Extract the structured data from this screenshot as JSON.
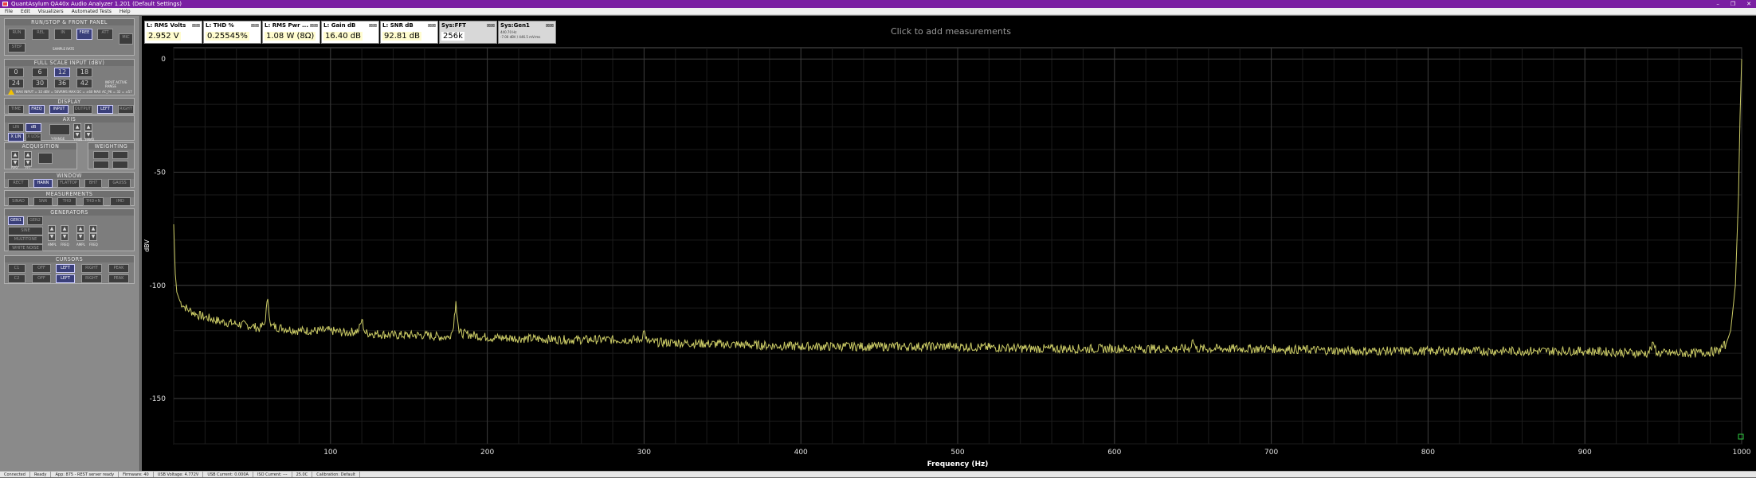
{
  "window": {
    "title": "QuantAsylum QA40x Audio Analyzer 1.201 (Default Settings)",
    "controls": [
      "–",
      "❐",
      "✕"
    ]
  },
  "menu": [
    "File",
    "Edit",
    "Visualizers",
    "Automated Tests",
    "Help"
  ],
  "panel": {
    "run": {
      "title": "RUN/STOP & FRONT PANEL",
      "buttons": [
        "RUN",
        "REL",
        "IN",
        "FREE",
        "ATT",
        "MIC"
      ],
      "bottom": [
        "STEP",
        "SAMPLE RATE"
      ]
    },
    "fullscale": {
      "title": "FULL SCALE INPUT (dBV)",
      "row1": [
        "0",
        "6",
        "12",
        "18"
      ],
      "row2": [
        "24",
        "30",
        "36",
        "42"
      ],
      "side": "INPUT ACTIVE RANGE",
      "warning": "MAX INPUT = 32 dBV = 56VRMS   MAX DC = ±60   MAX AC_PK = 32 = ±57"
    },
    "display": {
      "title": "DISPLAY",
      "buttons": [
        "TIME",
        "FREQ",
        "INPUT",
        "OUTPUT",
        "LEFT",
        "RIGHT"
      ]
    },
    "axis": {
      "title": "AXIS",
      "buttons": [
        "LIN",
        "dB",
        "X LIN",
        "X LOG"
      ],
      "spins": [
        "Y-RANGE",
        "Y-MIN",
        "Y-MAX"
      ]
    },
    "acquisition": {
      "title": "ACQUISITION",
      "avg": "AVG",
      "fft": "FFT"
    },
    "weighting": {
      "title": "WEIGHTING"
    },
    "window": {
      "title": "WINDOW",
      "buttons": [
        "RECT",
        "HANN",
        "FLATTOP",
        "BH7",
        "GAUSS"
      ]
    },
    "measurements": {
      "title": "MEASUREMENTS",
      "buttons": [
        "SINAD",
        "SNR",
        "THD",
        "THD+N",
        "IMD"
      ]
    },
    "generators": {
      "title": "GENERATORS",
      "buttons": [
        "GEN1",
        "GEN2",
        "SINE",
        "MULTITONE",
        "WHITE NOISE",
        "EXPO CHIRP"
      ],
      "labels": [
        "AMPL",
        "FREQ",
        "AMPL",
        "FREQ"
      ]
    },
    "cursors": {
      "title": "CURSORS",
      "row1": [
        "C1",
        "OFF",
        "LEFT",
        "RIGHT",
        "PEAK"
      ],
      "row2": [
        "C2",
        "OFF",
        "LEFT",
        "RIGHT",
        "PEAK"
      ]
    }
  },
  "readouts": [
    {
      "title": "L: RMS Volts",
      "value": "2.952 V"
    },
    {
      "title": "L: THD %",
      "value": "0.25545%"
    },
    {
      "title": "L: RMS Pwr ...",
      "value": "1.08 W (8Ω)"
    },
    {
      "title": "L: Gain dB",
      "value": "16.40 dB"
    },
    {
      "title": "L: SNR dB",
      "value": "92.81 dB"
    },
    {
      "title": "Sys:FFT",
      "value": "256k"
    },
    {
      "title": "Sys:Gen1",
      "value": "",
      "sub": [
        "440.70 Hz",
        "-7.00 dBV / 446.5 mVrms"
      ]
    }
  ],
  "add_measurements": "Click to add measurements",
  "status": [
    "Connected",
    "Ready",
    "App: 875 - REST server ready",
    "Firmware: 40",
    "USB Voltage: 4.772V",
    "USB Current: 0.000A",
    "ISO Current: ---",
    "25.0C",
    "Calibration: Default"
  ],
  "chart_data": {
    "type": "line",
    "title": "",
    "xlabel": "Frequency (Hz)",
    "ylabel": "dBV",
    "xlim": [
      0,
      1000
    ],
    "ylim": [
      -170,
      5
    ],
    "x_ticks": [
      100,
      200,
      300,
      400,
      500,
      600,
      700,
      800,
      900,
      1000
    ],
    "y_ticks": [
      0,
      -50,
      -100,
      -150
    ],
    "grid": true,
    "line_color": "#cccc66",
    "grid_color": "#3a3a3a",
    "series": [
      {
        "points": [
          [
            0,
            -73
          ],
          [
            1,
            -95
          ],
          [
            2,
            -103
          ],
          [
            4,
            -107
          ],
          [
            6,
            -109
          ],
          [
            10,
            -111
          ],
          [
            15,
            -113
          ],
          [
            20,
            -114
          ],
          [
            30,
            -116
          ],
          [
            40,
            -117
          ],
          [
            50,
            -118
          ],
          [
            55,
            -119
          ],
          [
            58,
            -117
          ],
          [
            60,
            -106
          ],
          [
            62,
            -118
          ],
          [
            70,
            -119
          ],
          [
            80,
            -120
          ],
          [
            100,
            -120
          ],
          [
            110,
            -121
          ],
          [
            118,
            -120
          ],
          [
            120,
            -115
          ],
          [
            122,
            -121
          ],
          [
            140,
            -122
          ],
          [
            160,
            -122
          ],
          [
            175,
            -123
          ],
          [
            178,
            -120
          ],
          [
            180,
            -107
          ],
          [
            182,
            -121
          ],
          [
            200,
            -123
          ],
          [
            250,
            -124
          ],
          [
            298,
            -124
          ],
          [
            300,
            -120
          ],
          [
            302,
            -125
          ],
          [
            350,
            -126
          ],
          [
            400,
            -127
          ],
          [
            450,
            -127
          ],
          [
            500,
            -127
          ],
          [
            550,
            -128
          ],
          [
            600,
            -128
          ],
          [
            648,
            -128
          ],
          [
            650,
            -124
          ],
          [
            652,
            -128
          ],
          [
            700,
            -128
          ],
          [
            750,
            -129
          ],
          [
            800,
            -129
          ],
          [
            850,
            -129
          ],
          [
            900,
            -129
          ],
          [
            940,
            -130
          ],
          [
            944,
            -126
          ],
          [
            946,
            -130
          ],
          [
            970,
            -130
          ],
          [
            985,
            -129
          ],
          [
            990,
            -126
          ],
          [
            993,
            -120
          ],
          [
            996,
            -100
          ],
          [
            998,
            -60
          ],
          [
            999,
            -25
          ],
          [
            1000,
            0
          ]
        ]
      }
    ]
  }
}
